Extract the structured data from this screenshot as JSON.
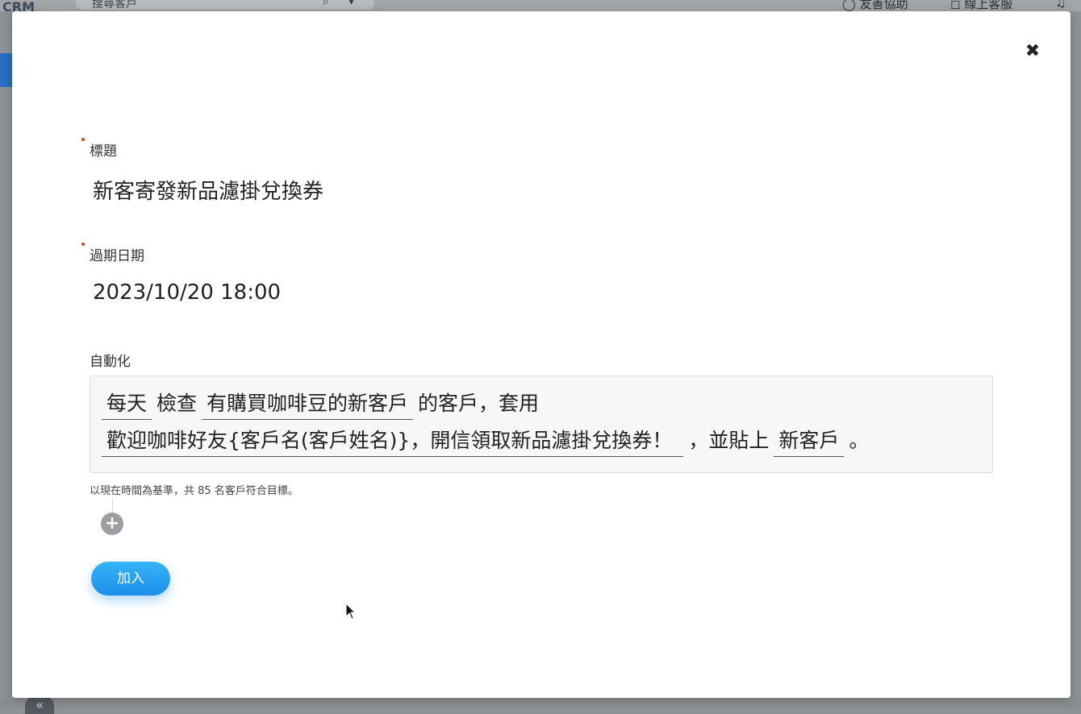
{
  "background": {
    "logo": "CRM",
    "search_placeholder": "搜尋客戶",
    "header_items": [
      "友善協助",
      "線上客服"
    ]
  },
  "modal": {
    "title_label": "標題",
    "title_value": "新客寄發新品濾掛兌換券",
    "expiry_label": "過期日期",
    "expiry_value": "2023/10/20 18:00",
    "automation_label": "自動化",
    "automation": {
      "line1": {
        "frequency": "每天",
        "verb": "檢查",
        "segment": "有購買咖啡豆的新客戶",
        "suffix": "的客戶，套用"
      },
      "line2": {
        "template": "歡迎咖啡好友{客戶名(客戶姓名)}，開信領取新品濾掛兌換券！",
        "connector": "，並貼上",
        "tag": "新客戶",
        "end": "。"
      }
    },
    "hint": "以現在時間為基準，共 85 名客戶符合目標。",
    "add_button_label": "加入"
  },
  "icons": {
    "close": "close-icon",
    "add": "plus-circle-icon",
    "collapse": "double-chevron-left-icon"
  },
  "colors": {
    "accent": "#1e8fec",
    "required": "#d6452e"
  }
}
